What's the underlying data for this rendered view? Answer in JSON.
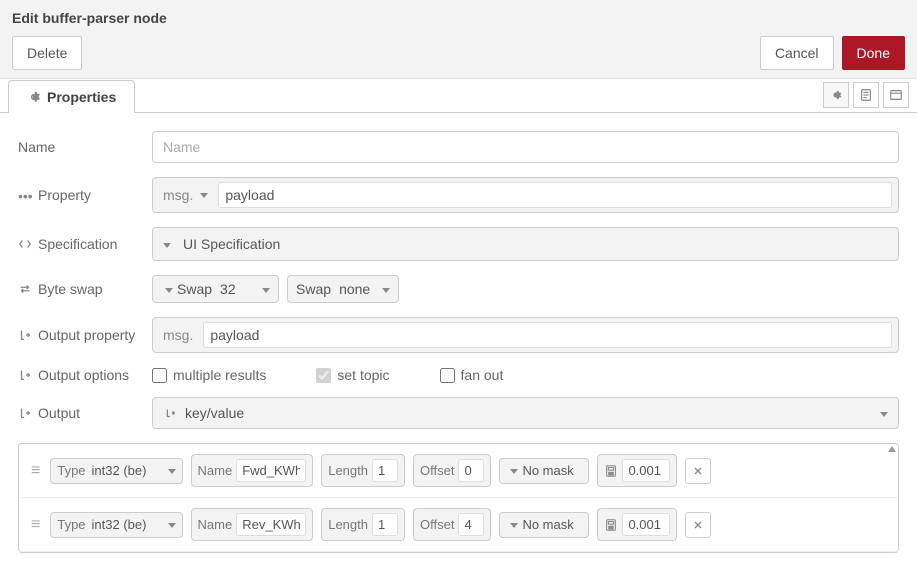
{
  "header": {
    "title": "Edit buffer-parser node",
    "delete_label": "Delete",
    "cancel_label": "Cancel",
    "done_label": "Done"
  },
  "tabs": {
    "properties_label": "Properties"
  },
  "form": {
    "name": {
      "label": "Name",
      "placeholder": "Name",
      "value": ""
    },
    "property": {
      "label": "Property",
      "prefix": "msg.",
      "value": "payload"
    },
    "specification": {
      "label": "Specification",
      "value": "UI Specification"
    },
    "byte_swap": {
      "label": "Byte swap",
      "swap1": {
        "label": "Swap",
        "value": "32"
      },
      "swap2": {
        "label": "Swap",
        "value": "none"
      }
    },
    "output_property": {
      "label": "Output property",
      "prefix": "msg.",
      "value": "payload"
    },
    "output_options": {
      "label": "Output options",
      "multiple_results": {
        "label": "multiple results",
        "checked": false
      },
      "set_topic": {
        "label": "set topic",
        "checked": true,
        "disabled": true
      },
      "fan_out": {
        "label": "fan out",
        "checked": false
      }
    },
    "output": {
      "label": "Output",
      "value": "key/value"
    }
  },
  "items_labels": {
    "type": "Type",
    "name": "Name",
    "length": "Length",
    "offset": "Offset",
    "mask_prefix": "",
    "scale": ""
  },
  "items": [
    {
      "type": "int32 (be)",
      "name": "Fwd_KWh",
      "length": "1",
      "offset": "0",
      "mask": "No mask",
      "scale": "0.001"
    },
    {
      "type": "int32 (be)",
      "name": "Rev_KWh",
      "length": "1",
      "offset": "4",
      "mask": "No mask",
      "scale": "0.001"
    }
  ]
}
